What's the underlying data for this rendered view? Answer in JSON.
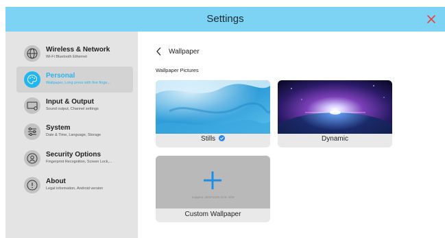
{
  "header": {
    "title": "Settings",
    "close_icon": "close-icon",
    "background_color": "#7dd3f3",
    "close_color": "#e8423b"
  },
  "sidebar": {
    "items": [
      {
        "title": "Wireless & Network",
        "subtitle": "Wi-Fi Bluetooth Ethernet",
        "icon": "globe-icon",
        "active": false
      },
      {
        "title": "Personal",
        "subtitle": "Wallpaper, Long press with five finge...",
        "icon": "palette-icon",
        "active": true
      },
      {
        "title": "Input & Output",
        "subtitle": "Sound output, Channel settings",
        "icon": "monitor-icon",
        "active": false
      },
      {
        "title": "System",
        "subtitle": "Date & Time, Language, Storage",
        "icon": "sliders-icon",
        "active": false
      },
      {
        "title": "Security Options",
        "subtitle": "Fingerprint Recognition, Screen Lock,...",
        "icon": "user-icon",
        "active": false
      },
      {
        "title": "About",
        "subtitle": "Legal information, Android version",
        "icon": "info-icon",
        "active": false
      }
    ],
    "active_color": "#22b6f0"
  },
  "main": {
    "back_icon": "chevron-left-icon",
    "title": "Wallpaper",
    "section_label": "Wallpaper Pictures",
    "cards": [
      {
        "label": "Stills",
        "selected": true,
        "image": "blue-watercolor-image"
      },
      {
        "label": "Dynamic",
        "selected": false,
        "image": "space-horizon-image"
      }
    ],
    "custom": {
      "label": "Custom Wallpaper",
      "hint": "Suggest: 3840*2160,Size: 40M",
      "icon": "plus-icon"
    }
  }
}
